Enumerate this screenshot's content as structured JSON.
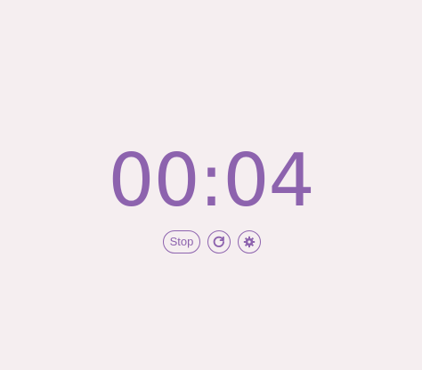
{
  "timer": {
    "display": "00:04"
  },
  "controls": {
    "stop_label": "Stop",
    "reset_icon": "restart-icon",
    "settings_icon": "gear-icon"
  },
  "colors": {
    "background": "#f5eef0",
    "accent": "#8d63ae"
  }
}
